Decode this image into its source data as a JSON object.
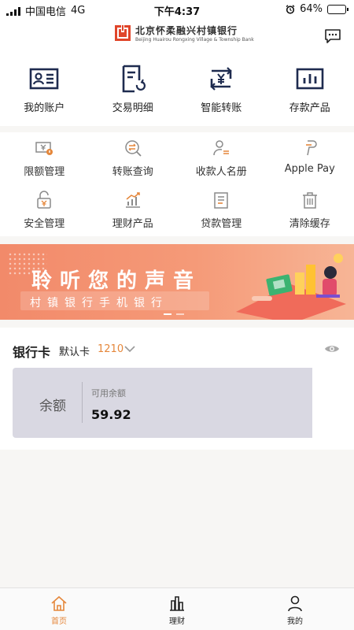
{
  "status_bar": {
    "carrier": "中国电信",
    "network": "4G",
    "time": "下午4:37",
    "battery": "64%",
    "battery_level": 0.64
  },
  "header": {
    "bank_name_cn": "北京怀柔融兴村镇银行",
    "bank_name_en": "Beijing Huairou Rongxing Village & Township Bank",
    "message_icon": "chat-bubble-icon"
  },
  "top_actions": [
    {
      "label": "我的账户",
      "icon": "id-card-icon"
    },
    {
      "label": "交易明细",
      "icon": "document-refresh-icon"
    },
    {
      "label": "智能转账",
      "icon": "yuan-transfer-icon"
    },
    {
      "label": "存款产品",
      "icon": "bar-chart-icon"
    }
  ],
  "secondary_actions": [
    {
      "label": "限额管理",
      "icon": "yuan-limit-icon"
    },
    {
      "label": "转账查询",
      "icon": "transfer-search-icon"
    },
    {
      "label": "收款人名册",
      "icon": "payee-icon"
    },
    {
      "label": "Apple Pay",
      "icon": "apple-pay-icon"
    },
    {
      "label": "安全管理",
      "icon": "lock-icon"
    },
    {
      "label": "理财产品",
      "icon": "trend-chart-icon"
    },
    {
      "label": "贷款管理",
      "icon": "loan-document-icon"
    },
    {
      "label": "清除缓存",
      "icon": "trash-icon"
    }
  ],
  "banner": {
    "headline": "聆听您的声音",
    "subline": "村镇银行手机银行",
    "pages": 2,
    "active_page": 0
  },
  "cards": {
    "title": "银行卡",
    "default_label": "默认卡",
    "last4": "1210",
    "balance_label": "余额",
    "available_label": "可用余额",
    "available_value": "59.92"
  },
  "tabs": [
    {
      "label": "首页",
      "icon": "home-icon",
      "active": true
    },
    {
      "label": "理财",
      "icon": "buildings-icon",
      "active": false
    },
    {
      "label": "我的",
      "icon": "person-icon",
      "active": false
    }
  ],
  "colors": {
    "accent": "#e5873b",
    "icon_navy": "#1e2b4f",
    "secondary_icon": "#8a8a8a",
    "banner": "#f28a6a",
    "card_bg": "#d9d8e2"
  }
}
